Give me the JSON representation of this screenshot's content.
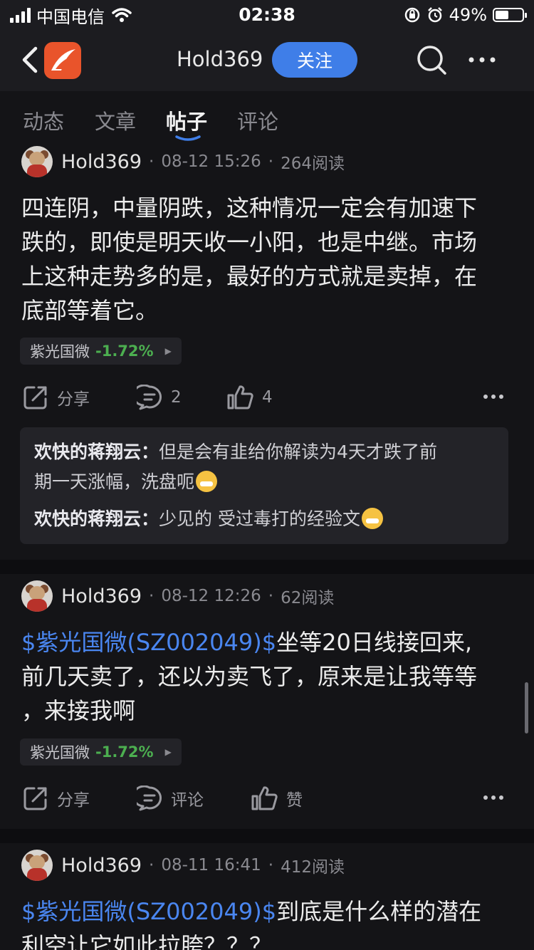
{
  "status_bar": {
    "carrier": "中国电信",
    "time": "02:38",
    "battery_percent": "49%",
    "battery_level": 0.49,
    "icons": [
      "signal-icon",
      "wifi-icon",
      "orientation-lock-icon",
      "alarm-icon",
      "battery-icon"
    ]
  },
  "nav": {
    "title": "Hold369",
    "follow_label": "关注",
    "brand_color": "#e9542b",
    "accent_color": "#3f7ee8"
  },
  "tabs": [
    {
      "label": "动态",
      "active": false
    },
    {
      "label": "文章",
      "active": false
    },
    {
      "label": "帖子",
      "active": true
    },
    {
      "label": "评论",
      "active": false
    }
  ],
  "posts": [
    {
      "author": "Hold369",
      "meta_sep": "·",
      "time": "08-12 15:26",
      "reads": "264阅读",
      "text_lines": [
        "四连阴，中量阴跌，这种情况一定会有加速下",
        "跌的，即使是明天收一小阳，也是中继。市场",
        "上这种走势多的是，最好的方式就是卖掉，在",
        "底部等着它。"
      ],
      "stock": {
        "name": "紫光国微",
        "change": "-1.72%",
        "arrow": "▶"
      },
      "share_label": "分享",
      "comment_count": "2",
      "like_count": "4",
      "comments": [
        {
          "user": "欢快的蒋翔云",
          "sep": "：",
          "line1": "但是会有韭给你解读为4天才跌了前",
          "line2": "期一天涨幅，洗盘呃"
        },
        {
          "user": "欢快的蒋翔云",
          "sep": "：",
          "line1": "少见的 受过毒打的经验文"
        }
      ]
    },
    {
      "author": "Hold369",
      "meta_sep": "·",
      "time": "08-12 12:26",
      "reads": "62阅读",
      "cashtag": "$紫光国微(SZ002049)$",
      "line1_rest": "坐等20日线接回来,",
      "line2": "前几天卖了，还以为卖飞了，原来是让我等等",
      "line3": "，来接我啊",
      "stock": {
        "name": "紫光国微",
        "change": "-1.72%",
        "arrow": "▶"
      },
      "share_label": "分享",
      "comment_label": "评论",
      "like_label": "赞"
    },
    {
      "author": "Hold369",
      "meta_sep": "·",
      "time": "08-11 16:41",
      "reads": "412阅读",
      "cashtag": "$紫光国微(SZ002049)$",
      "line1_rest": "到底是什么样的潜在",
      "line2": "利空让它如此拉胯？？？"
    }
  ]
}
